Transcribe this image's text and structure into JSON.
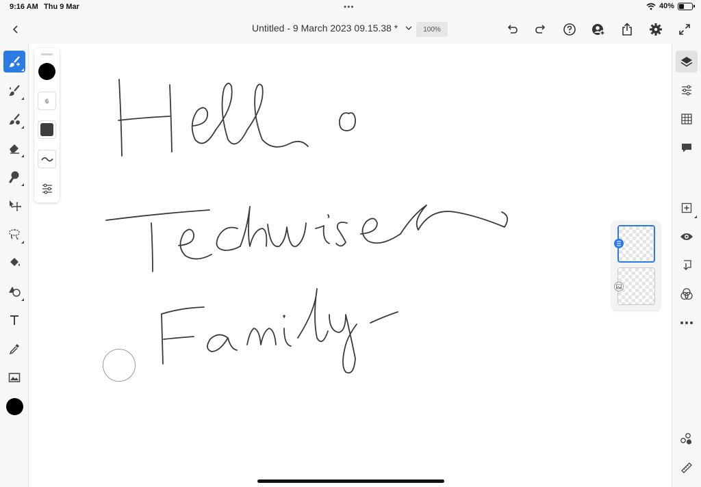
{
  "status_bar": {
    "time": "9:16 AM",
    "date": "Thu 9 Mar",
    "battery_percent": "40%",
    "battery_level": 0.4
  },
  "top_bar": {
    "title": "Untitled - 9 March 2023 09.15.38 *",
    "zoom": "100%",
    "icons": [
      "back-chevron-icon",
      "title-chevron-icon",
      "undo-icon",
      "redo-icon",
      "help-icon",
      "add-person-icon",
      "share-icon",
      "settings-icon",
      "fullscreen-icon"
    ]
  },
  "left_toolbar": {
    "tools": [
      "brush-tool",
      "mixer-brush-tool",
      "fill-brush-tool",
      "eraser-tool",
      "smudge-tool",
      "move-tool",
      "lasso-tool",
      "paint-bucket-tool",
      "shapes-tool",
      "text-tool",
      "eyedropper-tool",
      "image-tool"
    ],
    "active_tool": "brush-tool",
    "current_color": "#000000"
  },
  "brush_panel": {
    "color": "#000000",
    "size": "6"
  },
  "canvas": {
    "strokes": [
      "Hello",
      "Techwiser",
      "Family"
    ]
  },
  "right_toolbar": {
    "icons": [
      "layers-icon",
      "adjustments-icon",
      "grid-icon",
      "comments-icon",
      "add-layer-icon",
      "visibility-icon",
      "merge-down-icon",
      "blend-mode-icon",
      "more-icon",
      "libraries-icon",
      "ruler-icon"
    ]
  },
  "layers_panel": {
    "layers": [
      "layer-1",
      "layer-2"
    ],
    "active_layer": "layer-1"
  },
  "colors": {
    "accent": "#2c7be5",
    "ink": "#000000"
  }
}
